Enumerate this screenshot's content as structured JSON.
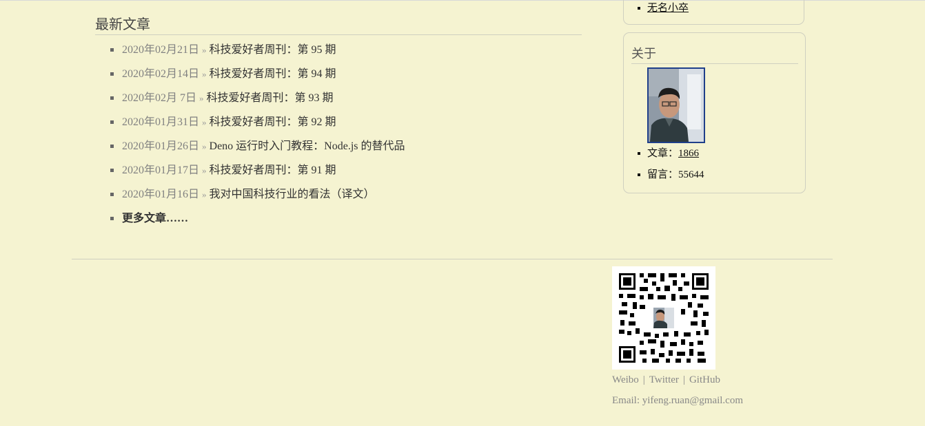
{
  "latest": {
    "title": "最新文章",
    "posts": [
      {
        "date": "2020年02月21日",
        "sep": "»",
        "title": "科技爱好者周刊：第 95 期"
      },
      {
        "date": "2020年02月14日",
        "sep": "»",
        "title": "科技爱好者周刊：第 94 期"
      },
      {
        "date": "2020年02月 7日",
        "sep": "»",
        "title": "科技爱好者周刊：第 93 期"
      },
      {
        "date": "2020年01月31日",
        "sep": "»",
        "title": "科技爱好者周刊：第 92 期"
      },
      {
        "date": "2020年01月26日",
        "sep": "»",
        "title": "Deno 运行时入门教程：Node.js 的替代品"
      },
      {
        "date": "2020年01月17日",
        "sep": "»",
        "title": "科技爱好者周刊：第 91 期"
      },
      {
        "date": "2020年01月16日",
        "sep": "»",
        "title": "我对中国科技行业的看法（译文）"
      }
    ],
    "more_label": "更多文章……"
  },
  "sidebar": {
    "prev_item": "无名小卒",
    "about": {
      "title": "关于",
      "posts_label": "文章：",
      "posts_count": "1866",
      "comments_label": "留言：",
      "comments_count": "55644"
    }
  },
  "footer": {
    "links": [
      "Weibo",
      "Twitter",
      "GitHub"
    ],
    "separator": "|",
    "email": "Email: yifeng.ruan@gmail.com"
  },
  "colors": {
    "background": "#F5F3D1",
    "avatar_border": "#1f3f8a",
    "muted_text": "#888888"
  }
}
